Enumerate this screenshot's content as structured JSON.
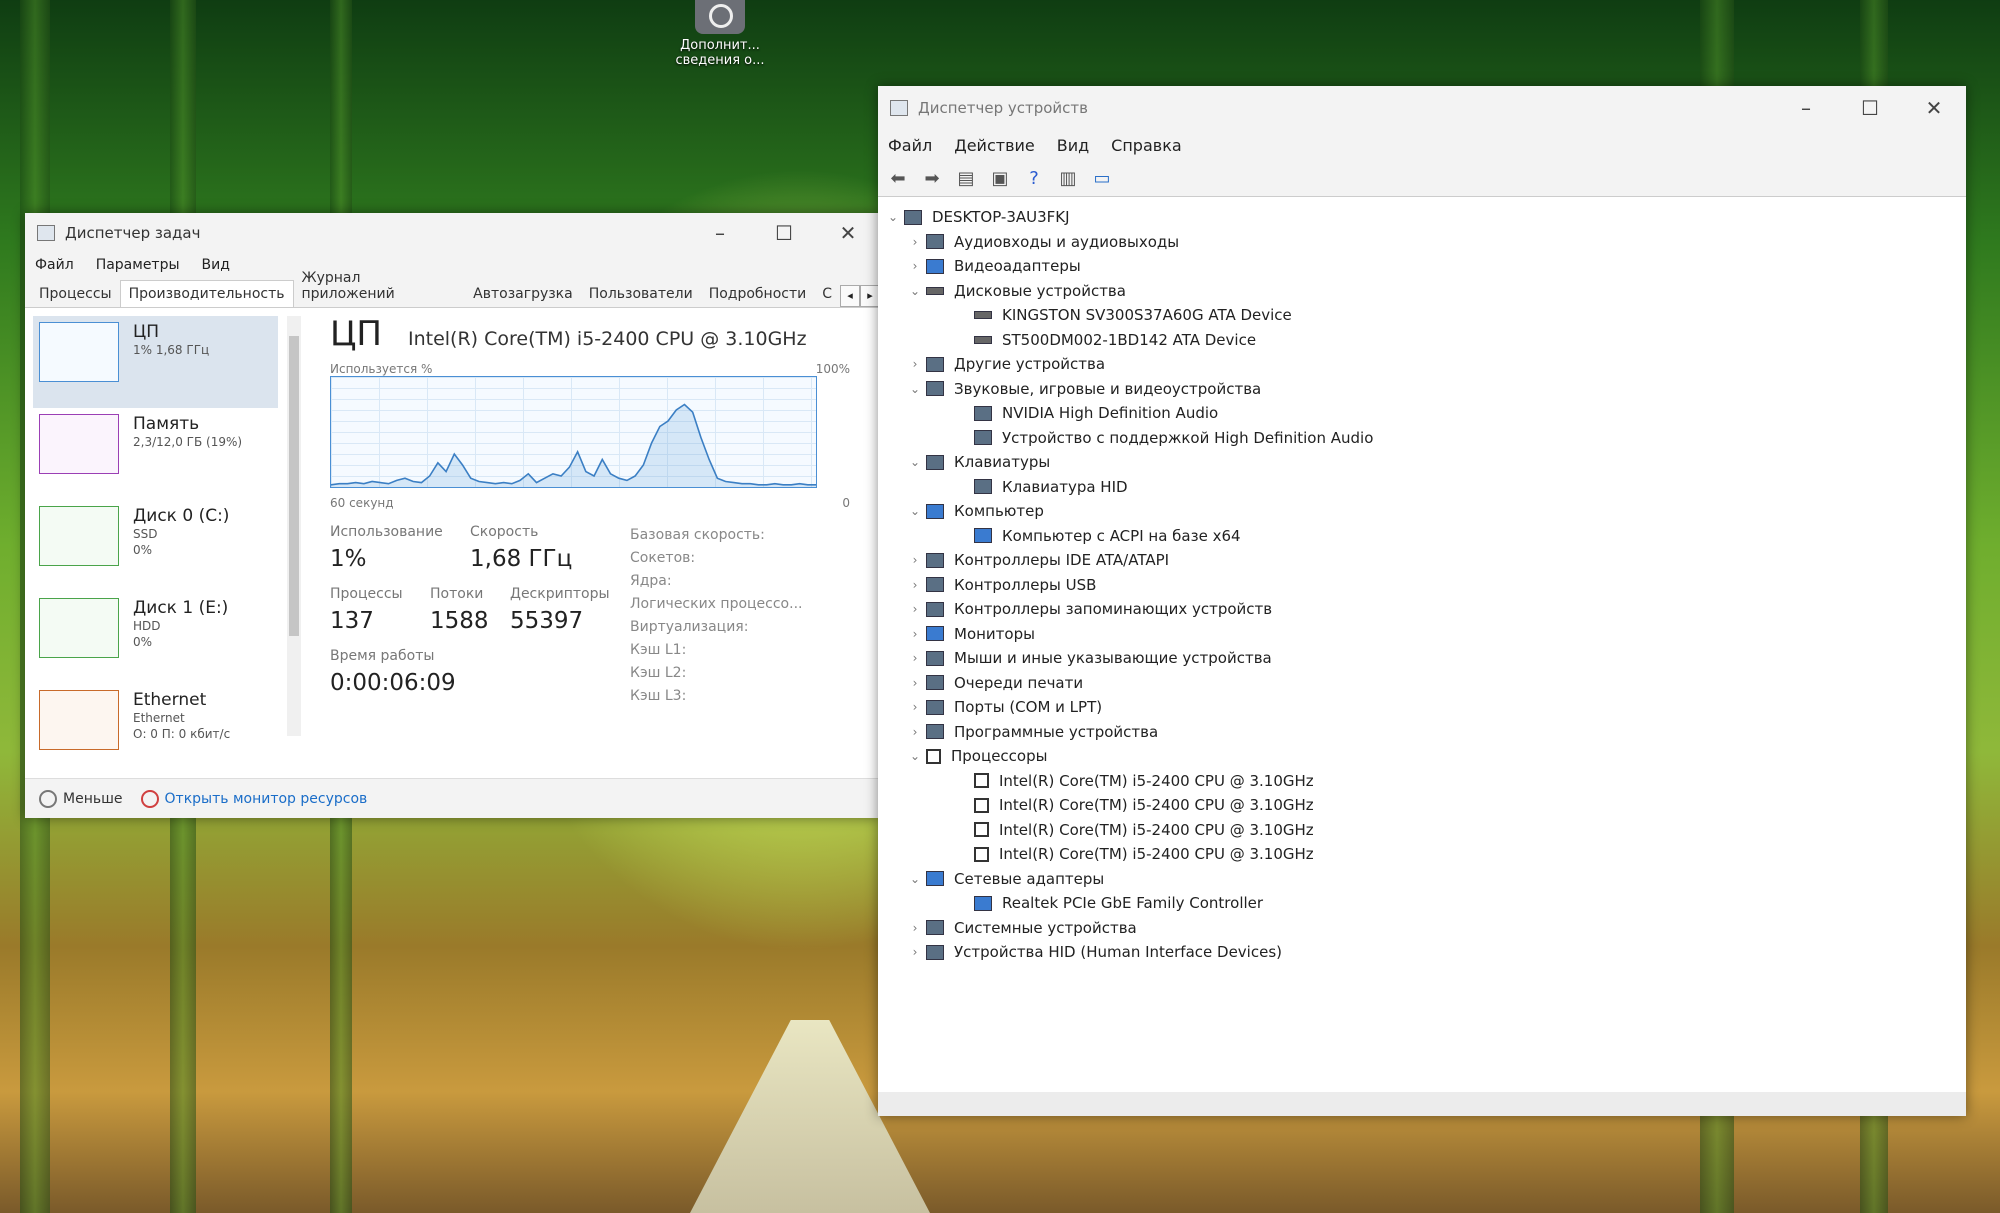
{
  "desktop": {
    "icon_label": "Дополнит... сведения о..."
  },
  "task_manager": {
    "title": "Диспетчер задач",
    "menu": [
      "Файл",
      "Параметры",
      "Вид"
    ],
    "tabs": [
      "Процессы",
      "Производительность",
      "Журнал приложений",
      "Автозагрузка",
      "Пользователи",
      "Подробности",
      "С"
    ],
    "active_tab": "Производительность",
    "sidebar": [
      {
        "name": "ЦП",
        "sub1": "1% 1,68 ГГц",
        "sub2": "",
        "icon": "cpu-graph"
      },
      {
        "name": "Память",
        "sub1": "2,3/12,0 ГБ (19%)",
        "sub2": "",
        "icon": "memory-graph"
      },
      {
        "name": "Диск 0 (C:)",
        "sub1": "SSD",
        "sub2": "0%",
        "icon": "disk-graph"
      },
      {
        "name": "Диск 1 (E:)",
        "sub1": "HDD",
        "sub2": "0%",
        "icon": "disk-graph"
      },
      {
        "name": "Ethernet",
        "sub1": "Ethernet",
        "sub2": "О: 0 П: 0 кбит/с",
        "icon": "ethernet-graph"
      }
    ],
    "cpu": {
      "heading": "ЦП",
      "model": "Intel(R) Core(TM) i5-2400 CPU @ 3.10GHz",
      "graph_label_left": "Используется %",
      "graph_label_right": "100%",
      "time_label_left": "60 секунд",
      "time_label_right": "0",
      "usage_label": "Использование",
      "usage_value": "1%",
      "speed_label": "Скорость",
      "speed_value": "1,68 ГГц",
      "processes_label": "Процессы",
      "processes_value": "137",
      "threads_label": "Потоки",
      "threads_value": "1588",
      "handles_label": "Дескрипторы",
      "handles_value": "55397",
      "uptime_label": "Время работы",
      "uptime_value": "0:00:06:09",
      "details": [
        "Базовая скорость:",
        "Сокетов:",
        "Ядра:",
        "Логических процессо...",
        "Виртуализация:",
        "Кэш L1:",
        "Кэш L2:",
        "Кэш L3:"
      ],
      "usage_history": [
        2,
        3,
        3,
        4,
        3,
        5,
        4,
        3,
        6,
        8,
        5,
        4,
        10,
        22,
        14,
        30,
        20,
        8,
        5,
        4,
        3,
        4,
        3,
        6,
        12,
        4,
        8,
        12,
        10,
        18,
        32,
        14,
        10,
        25,
        12,
        8,
        6,
        10,
        20,
        40,
        55,
        60,
        70,
        75,
        68,
        45,
        25,
        8,
        5,
        4,
        3,
        3,
        2,
        2,
        3,
        2,
        2,
        3,
        2,
        2
      ]
    },
    "footer_less": "Меньше",
    "footer_link": "Открыть монитор ресурсов"
  },
  "device_manager": {
    "title": "Диспетчер устройств",
    "menu": [
      "Файл",
      "Действие",
      "Вид",
      "Справка"
    ],
    "toolbar": [
      "back-icon",
      "forward-icon",
      "properties-icon",
      "refresh-icon",
      "help-icon",
      "view-icon",
      "monitor-icon"
    ],
    "tree": [
      {
        "level": 0,
        "expanded": true,
        "label": "DESKTOP-3AU3FKJ",
        "icon": "computer"
      },
      {
        "level": 1,
        "expanded": false,
        "label": "Аудиовходы и аудиовыходы",
        "icon": "audio"
      },
      {
        "level": 1,
        "expanded": false,
        "label": "Видеоадаптеры",
        "icon": "monitor"
      },
      {
        "level": 1,
        "expanded": true,
        "label": "Дисковые устройства",
        "icon": "drive"
      },
      {
        "level": 2,
        "label": "KINGSTON SV300S37A60G ATA Device",
        "icon": "drive"
      },
      {
        "level": 2,
        "label": "ST500DM002-1BD142 ATA Device",
        "icon": "drive"
      },
      {
        "level": 1,
        "expanded": false,
        "label": "Другие устройства",
        "icon": "unknown"
      },
      {
        "level": 1,
        "expanded": true,
        "label": "Звуковые, игровые и видеоустройства",
        "icon": "audio"
      },
      {
        "level": 2,
        "label": "NVIDIA High Definition Audio",
        "icon": "audio"
      },
      {
        "level": 2,
        "label": "Устройство с поддержкой High Definition Audio",
        "icon": "audio"
      },
      {
        "level": 1,
        "expanded": true,
        "label": "Клавиатуры",
        "icon": "keyboard"
      },
      {
        "level": 2,
        "label": "Клавиатура HID",
        "icon": "keyboard"
      },
      {
        "level": 1,
        "expanded": true,
        "label": "Компьютер",
        "icon": "monitor"
      },
      {
        "level": 2,
        "label": "Компьютер с ACPI на базе x64",
        "icon": "monitor"
      },
      {
        "level": 1,
        "expanded": false,
        "label": "Контроллеры IDE ATA/ATAPI",
        "icon": "controller"
      },
      {
        "level": 1,
        "expanded": false,
        "label": "Контроллеры USB",
        "icon": "usb"
      },
      {
        "level": 1,
        "expanded": false,
        "label": "Контроллеры запоминающих устройств",
        "icon": "controller"
      },
      {
        "level": 1,
        "expanded": false,
        "label": "Мониторы",
        "icon": "monitor"
      },
      {
        "level": 1,
        "expanded": false,
        "label": "Мыши и иные указывающие устройства",
        "icon": "mouse"
      },
      {
        "level": 1,
        "expanded": false,
        "label": "Очереди печати",
        "icon": "printer"
      },
      {
        "level": 1,
        "expanded": false,
        "label": "Порты (COM и LPT)",
        "icon": "port"
      },
      {
        "level": 1,
        "expanded": false,
        "label": "Программные устройства",
        "icon": "software"
      },
      {
        "level": 1,
        "expanded": true,
        "label": "Процессоры",
        "icon": "cpu"
      },
      {
        "level": 2,
        "label": "Intel(R) Core(TM) i5-2400 CPU @ 3.10GHz",
        "icon": "cpu"
      },
      {
        "level": 2,
        "label": "Intel(R) Core(TM) i5-2400 CPU @ 3.10GHz",
        "icon": "cpu"
      },
      {
        "level": 2,
        "label": "Intel(R) Core(TM) i5-2400 CPU @ 3.10GHz",
        "icon": "cpu"
      },
      {
        "level": 2,
        "label": "Intel(R) Core(TM) i5-2400 CPU @ 3.10GHz",
        "icon": "cpu"
      },
      {
        "level": 1,
        "expanded": true,
        "label": "Сетевые адаптеры",
        "icon": "network"
      },
      {
        "level": 2,
        "label": "Realtek PCIe GbE Family Controller",
        "icon": "network"
      },
      {
        "level": 1,
        "expanded": false,
        "label": "Системные устройства",
        "icon": "system"
      },
      {
        "level": 1,
        "expanded": false,
        "label": "Устройства HID (Human Interface Devices)",
        "icon": "hid"
      }
    ]
  }
}
